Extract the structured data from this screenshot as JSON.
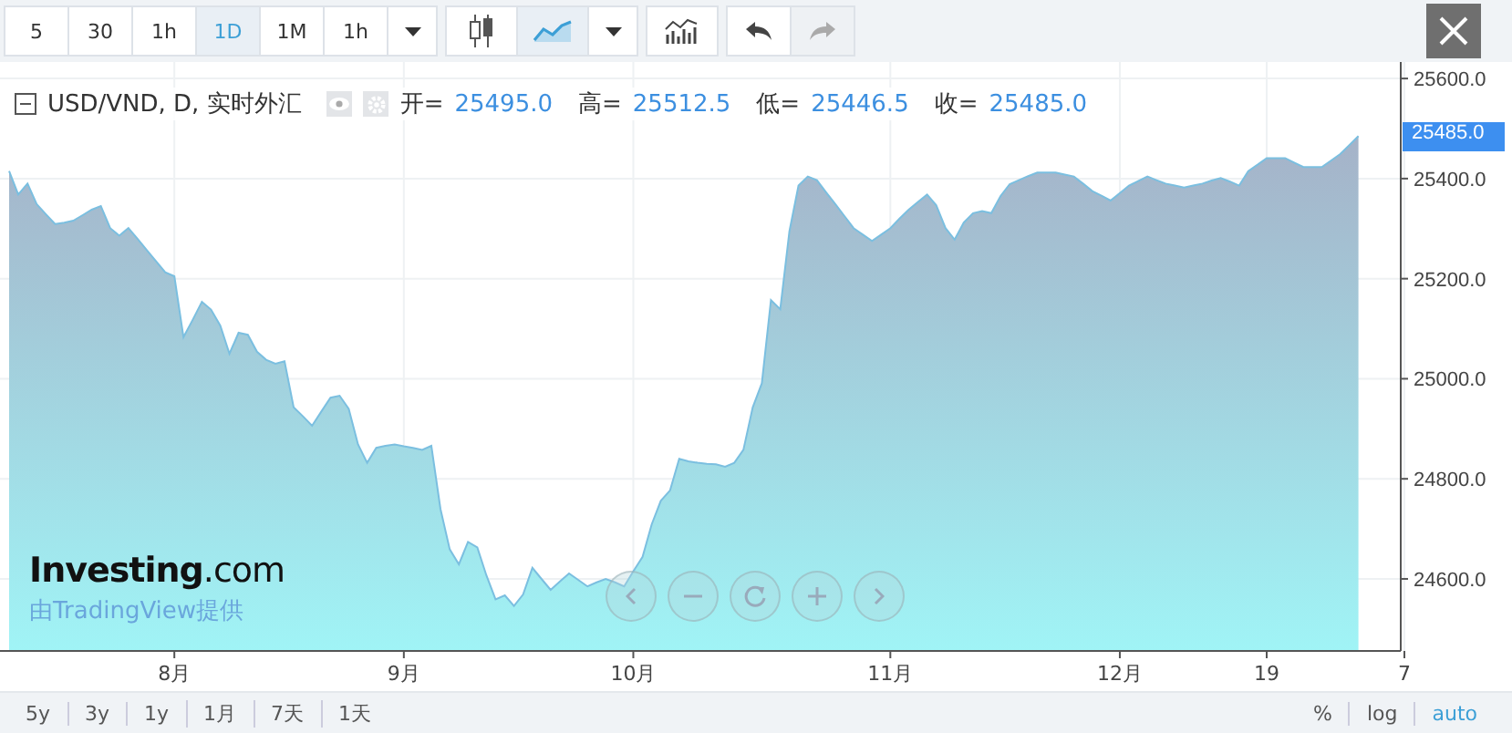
{
  "toolbar": {
    "intervals": [
      {
        "label": "5",
        "selected": false
      },
      {
        "label": "30",
        "selected": false
      },
      {
        "label": "1h",
        "selected": false
      },
      {
        "label": "1D",
        "selected": true
      },
      {
        "label": "1M",
        "selected": false
      },
      {
        "label": "1h",
        "selected": false
      }
    ],
    "chart_types": [
      {
        "kind": "candles",
        "selected": false
      },
      {
        "kind": "area",
        "selected": true
      }
    ],
    "history": [
      {
        "kind": "undo",
        "disabled": false
      },
      {
        "kind": "redo",
        "disabled": true
      }
    ]
  },
  "legend": {
    "title": "USD/VND, D, 实时外汇",
    "values": [
      {
        "label": "开=",
        "value": "25495.0"
      },
      {
        "label": "高=",
        "value": "25512.5"
      },
      {
        "label": "低=",
        "value": "25446.5"
      },
      {
        "label": "收=",
        "value": "25485.0"
      }
    ]
  },
  "branding": {
    "logo": "**Investing**.com",
    "credit": "由TradingView提供"
  },
  "current_price": "25485.0",
  "chart_data": {
    "type": "area",
    "grid": true,
    "ylim": [
      24456,
      25633
    ],
    "categories": [
      null,
      null,
      null,
      null,
      null,
      null,
      null,
      null,
      null,
      null,
      null,
      null,
      null,
      null,
      null,
      null,
      null,
      null,
      "8月",
      null,
      null,
      null,
      null,
      null,
      null,
      null,
      null,
      null,
      null,
      null,
      null,
      null,
      null,
      null,
      null,
      null,
      null,
      null,
      null,
      null,
      null,
      null,
      null,
      "9月",
      null,
      null,
      null,
      null,
      null,
      null,
      null,
      null,
      null,
      null,
      null,
      null,
      null,
      null,
      null,
      null,
      null,
      null,
      null,
      null,
      null,
      null,
      null,
      null,
      "10月",
      null,
      null,
      null,
      null,
      null,
      null,
      null,
      null,
      null,
      null,
      null,
      null,
      null,
      null,
      null,
      null,
      null,
      null,
      null,
      null,
      null,
      null,
      null,
      null,
      null,
      null,
      null,
      "11月",
      null,
      null,
      null,
      null,
      null,
      null,
      null,
      null,
      null,
      null,
      null,
      null,
      null,
      null,
      null,
      null,
      null,
      null,
      null,
      null,
      null,
      null,
      null,
      null,
      "12月",
      null,
      null,
      null,
      null,
      null,
      null,
      null,
      null,
      null,
      null,
      null,
      null,
      null,
      null,
      null,
      "19",
      null,
      null,
      null,
      null,
      null,
      null,
      null,
      null,
      null,
      null,
      null,
      null,
      null,
      null,
      "7"
    ],
    "series": [
      {
        "color": "#7bbfe0",
        "values": [
          25415,
          25368,
          25390,
          25349,
          25329,
          25309,
          25312,
          25316,
          25327,
          25338,
          25345,
          25301,
          25286,
          25301,
          25279,
          25257,
          25235,
          25213,
          25205,
          25083,
          25118,
          25154,
          25138,
          25106,
          25050,
          25092,
          25088,
          25054,
          25038,
          25030,
          25035,
          24943,
          24925,
          24906,
          24934,
          24962,
          24966,
          24940,
          24869,
          24832,
          24862,
          24866,
          24869,
          24865,
          24862,
          24858,
          24866,
          24740,
          24659,
          24629,
          24674,
          24663,
          24607,
          24559,
          24567,
          24546,
          24569,
          24622,
          24600,
          24578,
          24595,
          24611,
          24598,
          24585,
          24593,
          24600,
          24593,
          24585,
          24615,
          24644,
          24709,
          24756,
          24777,
          24840,
          24835,
          24832,
          24830,
          24829,
          24824,
          24832,
          24858,
          24943,
          24991,
          25157,
          25139,
          25294,
          25386,
          25404,
          25397,
          25373,
          25349,
          25325,
          25301,
          25288,
          25275,
          25288,
          25301,
          25320,
          25338,
          25353,
          25368,
          25347,
          25301,
          25278,
          25312,
          25331,
          25335,
          25331,
          25365,
          25389,
          25397,
          25405,
          25412,
          25412,
          25412,
          25408,
          25404,
          25390,
          25375,
          25366,
          25356,
          25371,
          25386,
          25395,
          25404,
          25397,
          25390,
          25386,
          25382,
          25386,
          25390,
          25396,
          25401,
          25394,
          25386,
          25415,
          25428,
          25441,
          25441,
          25441,
          25432,
          25423,
          25423,
          25423,
          25436,
          25449,
          25467,
          25485,
          null,
          null,
          null,
          null,
          null
        ]
      }
    ],
    "yticks": [
      {
        "value": 24600,
        "label": "24600.0"
      },
      {
        "value": 24800,
        "label": "24800.0"
      },
      {
        "value": 25000,
        "label": "25000.0"
      },
      {
        "value": 25200,
        "label": "25200.0"
      },
      {
        "value": 25400,
        "label": "25400.0"
      },
      {
        "value": 25600,
        "label": "25600.0"
      }
    ]
  },
  "ranges": [
    {
      "label": "5y"
    },
    {
      "label": "3y"
    },
    {
      "label": "1y"
    },
    {
      "label": "1月"
    },
    {
      "label": "7天"
    },
    {
      "label": "1天"
    }
  ],
  "scale_options": [
    {
      "label": "%",
      "selected": false
    },
    {
      "label": "log",
      "selected": false
    },
    {
      "label": "auto",
      "selected": true
    }
  ]
}
